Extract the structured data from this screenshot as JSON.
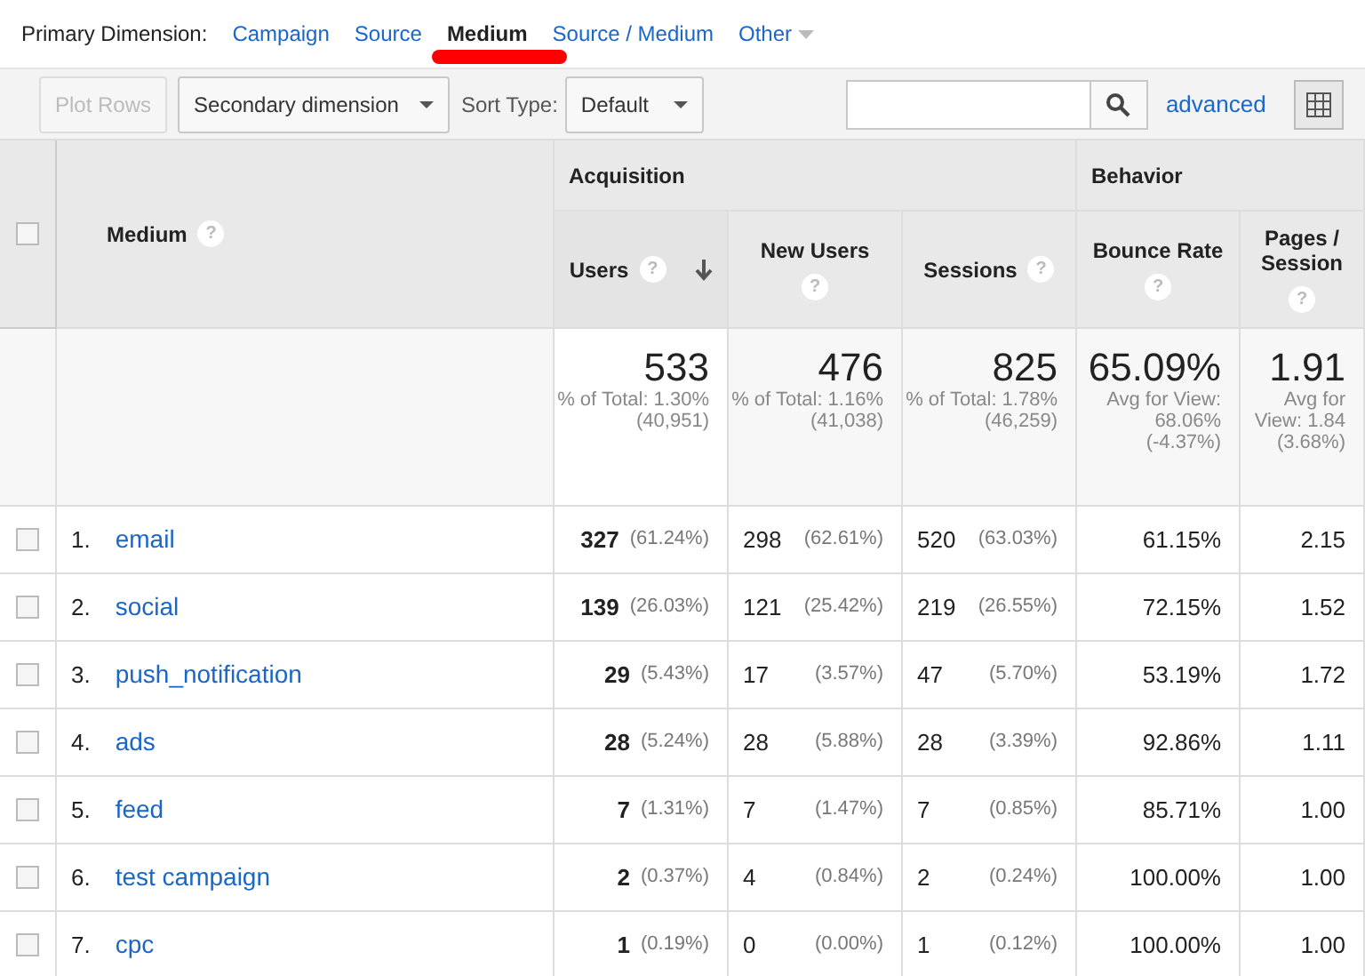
{
  "primary_dimension": {
    "label": "Primary Dimension:",
    "options": [
      {
        "label": "Campaign",
        "selected": false
      },
      {
        "label": "Source",
        "selected": false
      },
      {
        "label": "Medium",
        "selected": true
      },
      {
        "label": "Source / Medium",
        "selected": false
      },
      {
        "label": "Other",
        "selected": false,
        "kind": "dropdown"
      }
    ]
  },
  "toolbar": {
    "plot_rows": {
      "label": "Plot Rows",
      "disabled": true
    },
    "secondary_dimension": "Secondary dimension",
    "sort_type_label": "Sort Type:",
    "sort_type": "Default",
    "advanced": "advanced"
  },
  "table": {
    "select_all_checked": false,
    "help": "?",
    "dimension_header": "Medium",
    "groups": [
      {
        "label": "Acquisition"
      },
      {
        "label": "Behavior"
      }
    ],
    "columns": [
      {
        "label": "Users",
        "sorted": true
      },
      {
        "label": "New Users",
        "sorted": false
      },
      {
        "label": "Sessions",
        "sorted": false
      },
      {
        "label": "Bounce Rate",
        "sorted": false
      },
      {
        "label": "Pages / Session",
        "sorted": false
      }
    ],
    "totals": [
      {
        "value": "533",
        "note": "% of Total: 1.30% (40,951)"
      },
      {
        "value": "476",
        "note": "% of Total: 1.16% (41,038)"
      },
      {
        "value": "825",
        "note": "% of Total: 1.78% (46,259)"
      },
      {
        "value": "65.09%",
        "note": "Avg for View: 68.06% (-4.37%)"
      },
      {
        "value": "1.91",
        "note": "Avg for View: 1.84 (3.68%)"
      }
    ],
    "rows": [
      {
        "checked": false,
        "index": "1.",
        "name": "email",
        "users": "327",
        "users_pct": "(61.24%)",
        "new_users": "298",
        "new_users_pct": "(62.61%)",
        "sessions": "520",
        "sessions_pct": "(63.03%)",
        "bounce_rate": "61.15%",
        "pages_session": "2.15"
      },
      {
        "checked": false,
        "index": "2.",
        "name": "social",
        "users": "139",
        "users_pct": "(26.03%)",
        "new_users": "121",
        "new_users_pct": "(25.42%)",
        "sessions": "219",
        "sessions_pct": "(26.55%)",
        "bounce_rate": "72.15%",
        "pages_session": "1.52"
      },
      {
        "checked": false,
        "index": "3.",
        "name": "push_notification",
        "users": "29",
        "users_pct": "(5.43%)",
        "new_users": "17",
        "new_users_pct": "(3.57%)",
        "sessions": "47",
        "sessions_pct": "(5.70%)",
        "bounce_rate": "53.19%",
        "pages_session": "1.72"
      },
      {
        "checked": false,
        "index": "4.",
        "name": "ads",
        "users": "28",
        "users_pct": "(5.24%)",
        "new_users": "28",
        "new_users_pct": "(5.88%)",
        "sessions": "28",
        "sessions_pct": "(3.39%)",
        "bounce_rate": "92.86%",
        "pages_session": "1.11"
      },
      {
        "checked": false,
        "index": "5.",
        "name": "feed",
        "users": "7",
        "users_pct": "(1.31%)",
        "new_users": "7",
        "new_users_pct": "(1.47%)",
        "sessions": "7",
        "sessions_pct": "(0.85%)",
        "bounce_rate": "85.71%",
        "pages_session": "1.00"
      },
      {
        "checked": false,
        "index": "6.",
        "name": "test campaign",
        "users": "2",
        "users_pct": "(0.37%)",
        "new_users": "4",
        "new_users_pct": "(0.84%)",
        "sessions": "2",
        "sessions_pct": "(0.24%)",
        "bounce_rate": "100.00%",
        "pages_session": "1.00"
      },
      {
        "checked": false,
        "index": "7.",
        "name": "cpc",
        "users": "1",
        "users_pct": "(0.19%)",
        "new_users": "0",
        "new_users_pct": "(0.00%)",
        "sessions": "1",
        "sessions_pct": "(0.12%)",
        "bounce_rate": "100.00%",
        "pages_session": "1.00"
      }
    ]
  }
}
